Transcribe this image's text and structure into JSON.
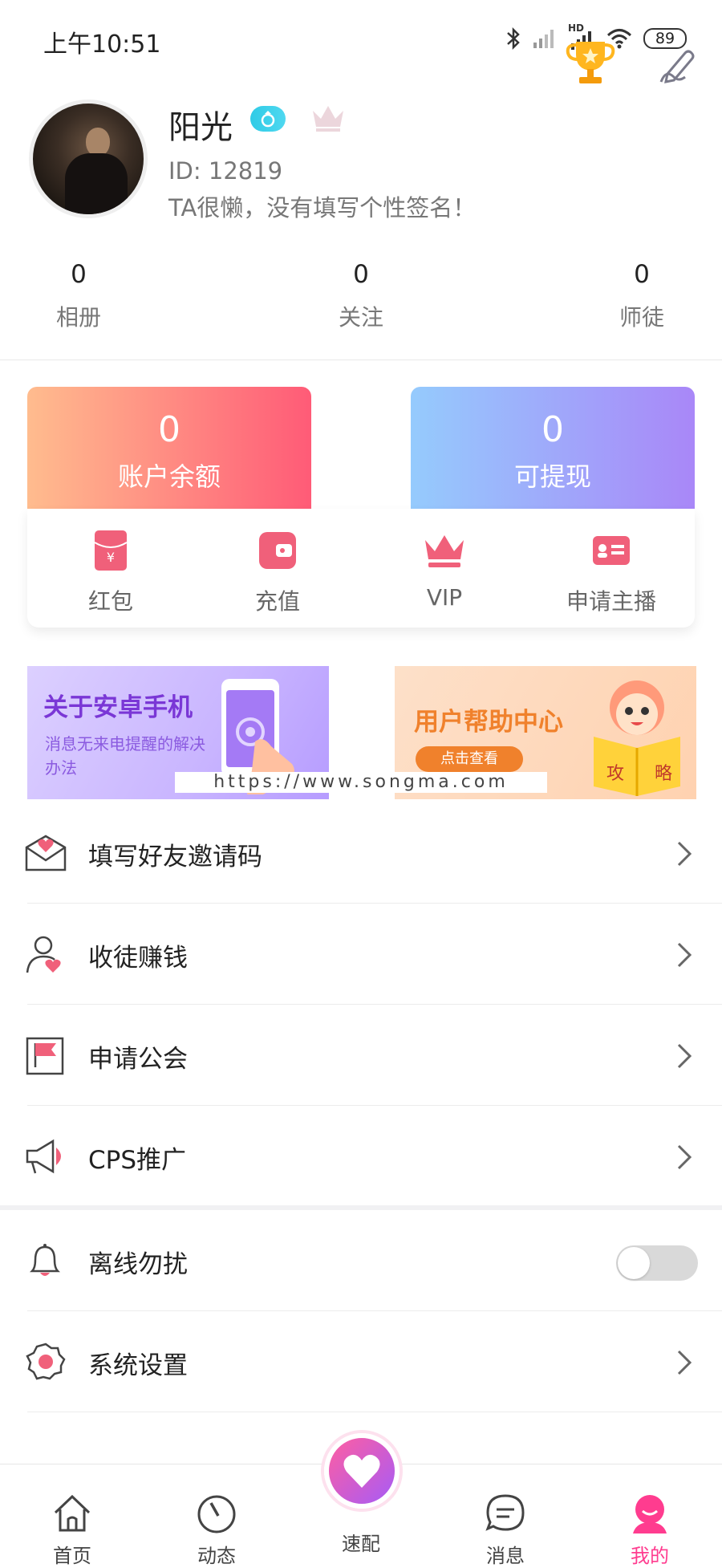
{
  "status_bar": {
    "time": "上午10:51",
    "network": "HD",
    "battery": "89"
  },
  "profile": {
    "nickname": "阳光",
    "id": "ID: 12819",
    "signature": "TA很懒，没有填写个性签名！"
  },
  "stats": [
    {
      "value": "0",
      "label": "相册"
    },
    {
      "value": "0",
      "label": "关注"
    },
    {
      "value": "0",
      "label": "师徒"
    }
  ],
  "wallet": {
    "balance": {
      "value": "0",
      "label": "账户余额"
    },
    "withdrawable": {
      "value": "0",
      "label": "可提现"
    }
  },
  "actions": [
    {
      "label": "红包",
      "icon": "red-envelope-icon"
    },
    {
      "label": "充值",
      "icon": "wallet-icon"
    },
    {
      "label": "VIP",
      "icon": "crown-icon"
    },
    {
      "label": "申请主播",
      "icon": "id-card-icon"
    }
  ],
  "banners": {
    "left": {
      "title": "关于安卓手机",
      "subtitle": "消息无来电提醒的解决办法"
    },
    "right": {
      "title": "用户帮助中心",
      "button": "点击查看",
      "book_text_1": "攻",
      "book_text_2": "略"
    }
  },
  "watermark": "https://www.songma.com",
  "menu": [
    {
      "label": "填写好友邀请码",
      "icon": "invite-envelope-icon"
    },
    {
      "label": "收徒赚钱",
      "icon": "apprentice-user-icon"
    },
    {
      "label": "申请公会",
      "icon": "flag-icon"
    },
    {
      "label": "CPS推广",
      "icon": "megaphone-icon"
    }
  ],
  "settings": [
    {
      "label": "离线勿扰",
      "icon": "bell-icon",
      "toggle": false
    },
    {
      "label": "系统设置",
      "icon": "gear-icon"
    }
  ],
  "tabbar": [
    {
      "label": "首页",
      "icon": "home-icon"
    },
    {
      "label": "动态",
      "icon": "dynamic-icon"
    },
    {
      "label": "速配",
      "icon": "heart-icon"
    },
    {
      "label": "消息",
      "icon": "message-icon"
    },
    {
      "label": "我的",
      "icon": "profile-icon",
      "active": true
    }
  ],
  "colors": {
    "accent_pink": "#ff3c8f",
    "balance_gradient": [
      "#ffbc8e",
      "#ff5b77"
    ],
    "withdraw_gradient": [
      "#95cbfd",
      "#a987f8"
    ],
    "icon_pink": "#f0607a"
  }
}
